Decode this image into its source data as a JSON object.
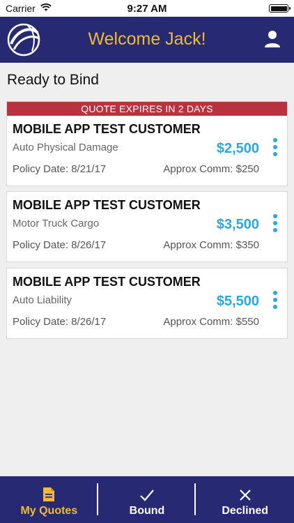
{
  "status_bar": {
    "carrier": "Carrier",
    "time": "9:27 AM"
  },
  "header": {
    "title": "Welcome Jack!",
    "logo_icon": "globe-logo-icon",
    "profile_icon": "person-icon"
  },
  "section_title": "Ready to Bind",
  "quotes": [
    {
      "banner": "QUOTE EXPIRES IN 2 DAYS",
      "customer": "MOBILE APP TEST CUSTOMER",
      "coverage": "Auto Physical Damage",
      "premium": "$2,500",
      "policy_date": "Policy Date: 8/21/17",
      "commission": "Approx Comm: $250"
    },
    {
      "customer": "MOBILE APP TEST CUSTOMER",
      "coverage": "Motor Truck Cargo",
      "premium": "$3,500",
      "policy_date": "Policy Date: 8/26/17",
      "commission": "Approx Comm: $350"
    },
    {
      "customer": "MOBILE APP TEST CUSTOMER",
      "coverage": "Auto Liability",
      "premium": "$5,500",
      "policy_date": "Policy Date: 8/26/17",
      "commission": "Approx Comm: $550"
    }
  ],
  "tabs": [
    {
      "label": "My Quotes",
      "icon": "document-icon",
      "active": true
    },
    {
      "label": "Bound",
      "icon": "checkmark-icon",
      "active": false
    },
    {
      "label": "Declined",
      "icon": "x-icon",
      "active": false
    }
  ],
  "colors": {
    "header_bg": "#272a72",
    "accent_gold": "#f1b93a",
    "premium_blue": "#2aa9de",
    "banner_red": "#b8323f"
  }
}
